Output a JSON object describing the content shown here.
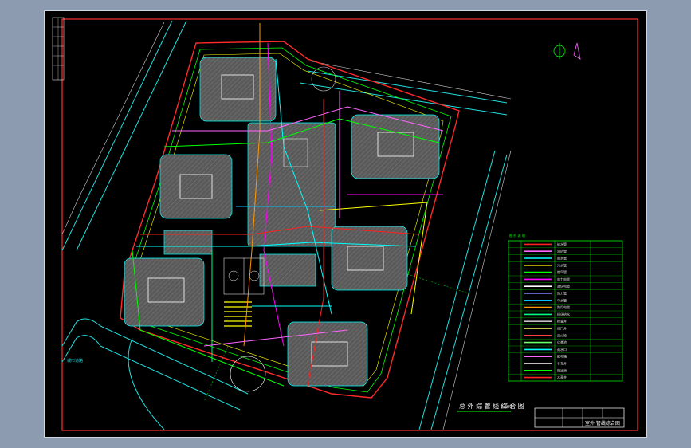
{
  "drawing": {
    "plan_title": "总 外 综 管 线 综 合 图",
    "scale": "1:500",
    "north_label": "N",
    "road_label": "城市道路",
    "title_block_name": "室外 管线综合图"
  },
  "legend": {
    "header": "图 例 说 明",
    "rows": [
      {
        "color": "#ff2020",
        "desc": "给水管"
      },
      {
        "color": "#ff66ff",
        "desc": "消防管"
      },
      {
        "color": "#00ffff",
        "desc": "雨水管"
      },
      {
        "color": "#ffff00",
        "desc": "污水管"
      },
      {
        "color": "#00ff00",
        "desc": "燃气管"
      },
      {
        "color": "#ff00ff",
        "desc": "电力电缆"
      },
      {
        "color": "#ffffff",
        "desc": "通信电缆"
      },
      {
        "color": "#8080ff",
        "desc": "热力管"
      },
      {
        "color": "#00c0ff",
        "desc": "中水管"
      },
      {
        "color": "#ff9900",
        "desc": "路灯电缆"
      },
      {
        "color": "#00ff80",
        "desc": "绿化给水"
      },
      {
        "color": "#c0c0c0",
        "desc": "检查井"
      },
      {
        "color": "#ffff66",
        "desc": "阀门井"
      },
      {
        "color": "#ff4040",
        "desc": "消火栓"
      },
      {
        "color": "#66ff66",
        "desc": "化粪池"
      },
      {
        "color": "#00ffff",
        "desc": "雨水口"
      },
      {
        "color": "#ff66ff",
        "desc": "配电箱"
      },
      {
        "color": "#ffffff",
        "desc": "手孔井"
      },
      {
        "color": "#00ff00",
        "desc": "隔油池"
      },
      {
        "color": "#ff2020",
        "desc": "水表井"
      }
    ]
  }
}
